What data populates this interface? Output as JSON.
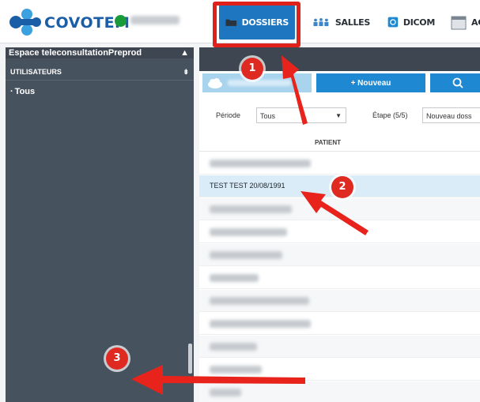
{
  "header": {
    "brand": "COVOTEM",
    "nav": [
      {
        "label": "DOSSIERS",
        "icon": "folder-icon",
        "active": true
      },
      {
        "label": "SALLES",
        "icon": "people-icon",
        "active": false
      },
      {
        "label": "DICOM",
        "icon": "dicom-icon",
        "active": false
      },
      {
        "label": "AG",
        "icon": "calendar-icon",
        "active": false
      }
    ]
  },
  "sidebar": {
    "title": "Espace teleconsultationPreprod",
    "section": "UTILISATEURS",
    "items": [
      "Tous"
    ]
  },
  "toolbar": {
    "new_label": "+ Nouveau",
    "search_icon": "search-icon"
  },
  "filters": {
    "period_label": "Période",
    "period_value": "Tous",
    "step_label": "Étape (5/5)",
    "step_value": "Nouveau doss"
  },
  "table": {
    "column": "PATIENT",
    "selected_row": "TEST TEST 20/08/1991"
  },
  "annotations": [
    "1",
    "2",
    "3"
  ],
  "colors": {
    "accent": "#1e76c1",
    "sidebar": "#47525f",
    "annotation": "#df2a22",
    "selected": "#d9ecf8"
  }
}
